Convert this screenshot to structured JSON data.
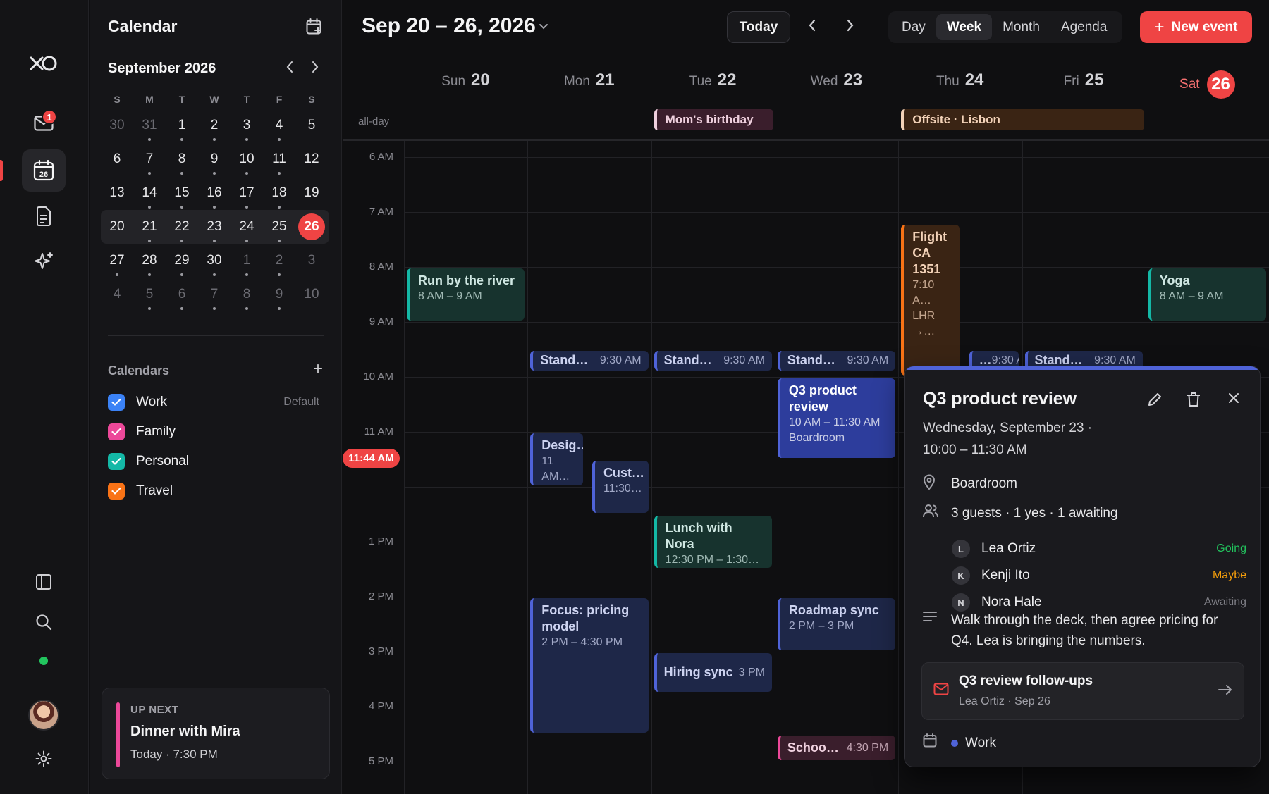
{
  "app": {
    "title": "Calendar"
  },
  "rail": {
    "mail_badge": "1"
  },
  "mini": {
    "month_label": "September 2026",
    "dow": [
      "S",
      "M",
      "T",
      "W",
      "T",
      "F",
      "S"
    ],
    "weeks": [
      [
        {
          "d": "30",
          "m": 1,
          "dot": 0
        },
        {
          "d": "31",
          "m": 1,
          "dot": 1
        },
        {
          "d": "1",
          "m": 0,
          "dot": 1
        },
        {
          "d": "2",
          "m": 0,
          "dot": 1
        },
        {
          "d": "3",
          "m": 0,
          "dot": 1
        },
        {
          "d": "4",
          "m": 0,
          "dot": 1
        },
        {
          "d": "5",
          "m": 0,
          "dot": 0
        }
      ],
      [
        {
          "d": "6",
          "m": 0,
          "dot": 0
        },
        {
          "d": "7",
          "m": 0,
          "dot": 1
        },
        {
          "d": "8",
          "m": 0,
          "dot": 1
        },
        {
          "d": "9",
          "m": 0,
          "dot": 1
        },
        {
          "d": "10",
          "m": 0,
          "dot": 1
        },
        {
          "d": "11",
          "m": 0,
          "dot": 1
        },
        {
          "d": "12",
          "m": 0,
          "dot": 0
        }
      ],
      [
        {
          "d": "13",
          "m": 0,
          "dot": 0
        },
        {
          "d": "14",
          "m": 0,
          "dot": 1
        },
        {
          "d": "15",
          "m": 0,
          "dot": 1
        },
        {
          "d": "16",
          "m": 0,
          "dot": 1
        },
        {
          "d": "17",
          "m": 0,
          "dot": 1
        },
        {
          "d": "18",
          "m": 0,
          "dot": 1
        },
        {
          "d": "19",
          "m": 0,
          "dot": 0
        }
      ],
      [
        {
          "d": "20",
          "m": 0,
          "dot": 0
        },
        {
          "d": "21",
          "m": 0,
          "dot": 1
        },
        {
          "d": "22",
          "m": 0,
          "dot": 1
        },
        {
          "d": "23",
          "m": 0,
          "dot": 1
        },
        {
          "d": "24",
          "m": 0,
          "dot": 1
        },
        {
          "d": "25",
          "m": 0,
          "dot": 1
        },
        {
          "d": "26",
          "m": 0,
          "dot": 0,
          "today": 1
        }
      ],
      [
        {
          "d": "27",
          "m": 0,
          "dot": 1
        },
        {
          "d": "28",
          "m": 0,
          "dot": 1
        },
        {
          "d": "29",
          "m": 0,
          "dot": 1
        },
        {
          "d": "30",
          "m": 0,
          "dot": 1
        },
        {
          "d": "1",
          "m": 1,
          "dot": 1
        },
        {
          "d": "2",
          "m": 1,
          "dot": 1
        },
        {
          "d": "3",
          "m": 1,
          "dot": 0
        }
      ],
      [
        {
          "d": "4",
          "m": 1,
          "dot": 0
        },
        {
          "d": "5",
          "m": 1,
          "dot": 1
        },
        {
          "d": "6",
          "m": 1,
          "dot": 1
        },
        {
          "d": "7",
          "m": 1,
          "dot": 1
        },
        {
          "d": "8",
          "m": 1,
          "dot": 1
        },
        {
          "d": "9",
          "m": 1,
          "dot": 1
        },
        {
          "d": "10",
          "m": 1,
          "dot": 0
        }
      ]
    ]
  },
  "calendars": {
    "heading": "Calendars",
    "items": [
      {
        "label": "Work",
        "color": "#3b82f6",
        "note": "Default"
      },
      {
        "label": "Family",
        "color": "#ec4899",
        "note": ""
      },
      {
        "label": "Personal",
        "color": "#14b8a6",
        "note": ""
      },
      {
        "label": "Travel",
        "color": "#f97316",
        "note": ""
      }
    ]
  },
  "upnext": {
    "label": "UP NEXT",
    "title": "Dinner with Mira",
    "when": "Today · 7:30 PM"
  },
  "toolbar": {
    "range": "Sep 20 – 26, 2026",
    "today": "Today",
    "views": [
      "Day",
      "Week",
      "Month",
      "Agenda"
    ],
    "active_view": "Week",
    "new_event": "New event"
  },
  "week": {
    "days": [
      {
        "dow": "Sun",
        "num": "20"
      },
      {
        "dow": "Mon",
        "num": "21"
      },
      {
        "dow": "Tue",
        "num": "22"
      },
      {
        "dow": "Wed",
        "num": "23"
      },
      {
        "dow": "Thu",
        "num": "24"
      },
      {
        "dow": "Fri",
        "num": "25"
      },
      {
        "dow": "Sat",
        "num": "26",
        "today": true
      }
    ],
    "allday_label": "all-day",
    "allday": [
      {
        "title": "Mom's birthday",
        "color": "pink",
        "start": 2,
        "span": 1
      },
      {
        "title": "Offsite · Lisbon",
        "color": "orange",
        "start": 4,
        "span": 2
      }
    ],
    "hours": [
      "6 AM",
      "7 AM",
      "8 AM",
      "9 AM",
      "10 AM",
      "11 AM",
      "",
      "1 PM",
      "2 PM",
      "3 PM",
      "4 PM",
      "5 PM"
    ],
    "now_label": "11:44 AM",
    "events": [
      {
        "day": 0,
        "start": 8.0,
        "end": 9.0,
        "title": "Run by the river",
        "sub": "8 AM – 9 AM",
        "color": "green"
      },
      {
        "day": 4,
        "start": 7.2,
        "end": 10.0,
        "title": "Flight CA 1351",
        "sub": "7:10 A… LHR →…",
        "color": "orange",
        "w": 0.52
      },
      {
        "day": 6,
        "start": 8.0,
        "end": 9.0,
        "title": "Yoga",
        "sub": "8 AM – 9 AM",
        "color": "green"
      },
      {
        "day": 1,
        "start": 9.5,
        "end": 9.9,
        "title": "Stand…",
        "sub": "9:30 AM",
        "color": "blue",
        "inline": true
      },
      {
        "day": 2,
        "start": 9.5,
        "end": 9.9,
        "title": "Stand…",
        "sub": "9:30 AM",
        "color": "blue",
        "inline": true
      },
      {
        "day": 3,
        "start": 9.5,
        "end": 9.9,
        "title": "Stand…",
        "sub": "9:30 AM",
        "color": "blue",
        "inline": true
      },
      {
        "day": 4,
        "start": 9.5,
        "end": 9.9,
        "title": "…",
        "sub": "9:30 AM",
        "color": "blue",
        "inline": true,
        "x": 0.55,
        "w": 0.45
      },
      {
        "day": 5,
        "start": 9.5,
        "end": 9.9,
        "title": "Stand…",
        "sub": "9:30 AM",
        "color": "blue",
        "inline": true
      },
      {
        "day": 3,
        "start": 10.0,
        "end": 11.5,
        "title": "Q3 product review",
        "sub": "10 AM – 11:30 AM",
        "sub2": "Boardroom",
        "color": "blue-strong"
      },
      {
        "day": 1,
        "start": 11.0,
        "end": 12.0,
        "title": "Desig…",
        "sub": "11 AM…",
        "color": "blue",
        "w": 0.47
      },
      {
        "day": 1,
        "start": 11.5,
        "end": 12.5,
        "title": "Cust…",
        "sub": "11:30…",
        "color": "blue",
        "x": 0.5,
        "w": 0.5
      },
      {
        "day": 2,
        "start": 12.5,
        "end": 13.5,
        "title": "Lunch with Nora",
        "sub": "12:30 PM – 1:30…",
        "color": "green"
      },
      {
        "day": 1,
        "start": 14.0,
        "end": 16.5,
        "title": "Focus: pricing model",
        "sub": "2 PM – 4:30 PM",
        "color": "blue"
      },
      {
        "day": 3,
        "start": 14.0,
        "end": 15.0,
        "title": "Roadmap sync",
        "sub": "2 PM – 3 PM",
        "color": "blue"
      },
      {
        "day": 2,
        "start": 15.0,
        "end": 15.75,
        "title": "Hiring sync",
        "sub": "3 PM",
        "color": "blue",
        "inline": true,
        "subnear": true
      },
      {
        "day": 3,
        "start": 16.5,
        "end": 17.0,
        "title": "Schoo…",
        "sub": "4:30 PM",
        "color": "pink",
        "inline": true
      }
    ]
  },
  "popover": {
    "title": "Q3 product review",
    "date_line1": "Wednesday, September 23 ·",
    "date_line2": "10:00 – 11:30 AM",
    "location": "Boardroom",
    "guests_summary": "3 guests · 1 yes · 1 awaiting",
    "guests": [
      {
        "initial": "L",
        "name": "Lea Ortiz",
        "status": "Going",
        "color": "#22c55e"
      },
      {
        "initial": "K",
        "name": "Kenji Ito",
        "status": "Maybe",
        "color": "#f59e0b"
      },
      {
        "initial": "N",
        "name": "Nora Hale",
        "status": "Awaiting",
        "color": "#7d7d84"
      }
    ],
    "description": "Walk through the deck, then agree pricing for Q4. Lea is bringing the numbers.",
    "link_title": "Q3 review follow-ups",
    "link_sub": "Lea Ortiz · Sep 26",
    "calendar": "Work"
  }
}
